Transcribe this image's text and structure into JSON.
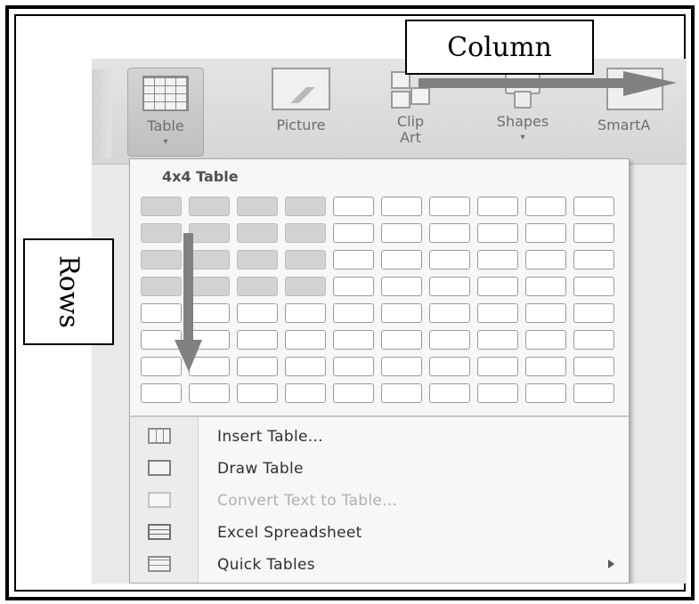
{
  "annotations": {
    "column_label": "Column",
    "rows_label": "Rows"
  },
  "ribbon": {
    "buttons": [
      {
        "label": "Table",
        "icon": "table-icon"
      },
      {
        "label": "Picture",
        "icon": "picture-icon"
      },
      {
        "label": "Clip Art",
        "line1": "Clip",
        "line2": "Art",
        "icon": "clip-art-icon"
      },
      {
        "label": "Shapes",
        "icon": "shapes-icon"
      },
      {
        "label": "SmartA",
        "icon": "smartart-icon"
      }
    ]
  },
  "menu": {
    "title": "4x4 Table",
    "grid": {
      "columns": 10,
      "rows": 8,
      "selected_columns": 4,
      "selected_rows": 4
    },
    "items": [
      {
        "label": "Insert Table...",
        "enabled": true,
        "icon": "insert-table-icon"
      },
      {
        "label": "Draw Table",
        "enabled": true,
        "icon": "draw-table-icon"
      },
      {
        "label": "Convert Text to Table...",
        "enabled": false,
        "icon": "convert-text-icon"
      },
      {
        "label": "Excel Spreadsheet",
        "enabled": true,
        "icon": "excel-spreadsheet-icon"
      },
      {
        "label": "Quick Tables",
        "enabled": true,
        "has_submenu": true,
        "icon": "quick-tables-icon"
      }
    ]
  },
  "colors": {
    "frame": "#000000",
    "menu_bg": "#f7f7f7",
    "selected_cell": "#d2d2d2",
    "arrow": "#808080"
  }
}
